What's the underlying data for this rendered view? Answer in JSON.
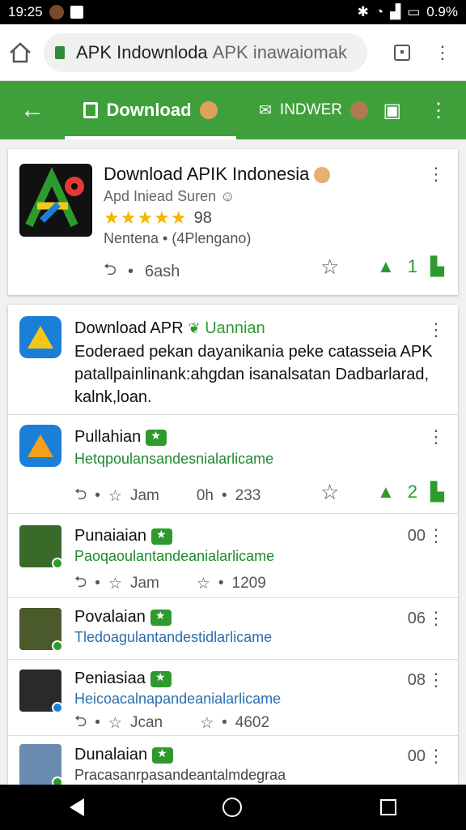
{
  "status": {
    "time": "19:25",
    "battery": "0.9%"
  },
  "browser": {
    "url_main": "APK Indownloda",
    "url_rest": "APK inawaiomak"
  },
  "tabs": {
    "active_label": "Download",
    "second_label": "INDWER"
  },
  "featured": {
    "title": "Download APIK Indonesia",
    "subtitle": "Apd Iniead Suren",
    "stars": "★★★★★",
    "rating": "98",
    "meta": "Nentena • (4Plengano)",
    "share_count": "6ash",
    "like_count": "1"
  },
  "post": {
    "title": "Download APR",
    "tag": "Uannian",
    "body": "Eoderaed pekan dayanikania peke catasseia APK patallpainlinank:ahgdan isanalsatan Dadbarlarad, kalnk,loan."
  },
  "rows": [
    {
      "title": "Pullahian",
      "sub": "Hetqpoulansandesnialarlicame",
      "num": "",
      "act_left": "Jam",
      "act_mid": "0h",
      "act_count": "233",
      "like": "2"
    },
    {
      "title": "Punaiaian",
      "sub": "Paoqaoulantandeanialarlicame",
      "num": "00",
      "act_left": "Jam",
      "act_count": "1209"
    },
    {
      "title": "Povalaian",
      "sub": "Tledoagulantandestidlarlicame",
      "num": "06"
    },
    {
      "title": "Peniasiaa",
      "sub": "Heicoacalnapandeanialarlicame",
      "num": "08",
      "act_left": "Jcan",
      "act_count": "4602"
    },
    {
      "title": "Dunalaian",
      "sub": "Pracasanrpasandeantalmdegraa",
      "num": "00"
    }
  ]
}
